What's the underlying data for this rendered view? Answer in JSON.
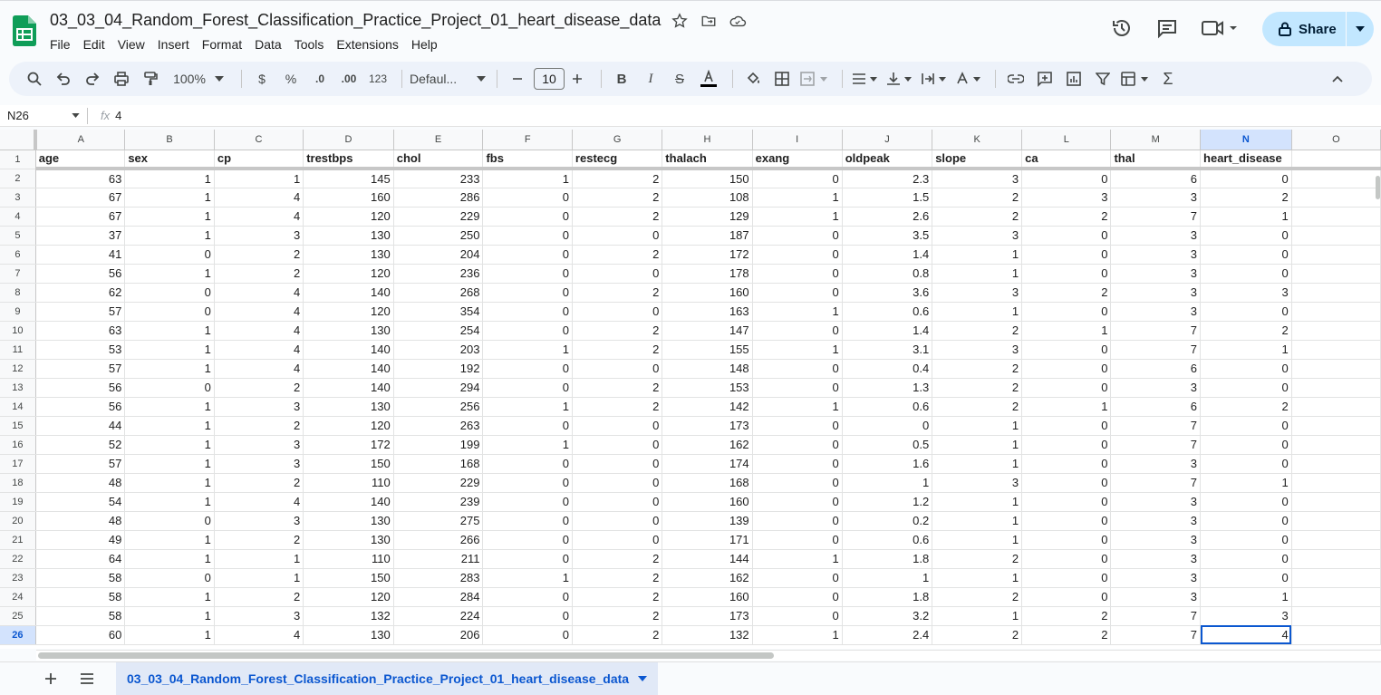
{
  "app": {
    "doc_title": "03_03_04_Random_Forest_Classification_Practice_Project_01_heart_disease_data",
    "share_label": "Share"
  },
  "menu": [
    "File",
    "Edit",
    "View",
    "Insert",
    "Format",
    "Data",
    "Tools",
    "Extensions",
    "Help"
  ],
  "toolbar": {
    "zoom": "100%",
    "currency": "$",
    "percent": "%",
    "dec_decrease": ".0",
    "dec_increase": ".00",
    "more_formats": "123",
    "font": "Defaul...",
    "font_size": "10"
  },
  "formula_bar": {
    "cell_ref": "N26",
    "fx": "fx",
    "value": "4"
  },
  "columns": [
    "A",
    "B",
    "C",
    "D",
    "E",
    "F",
    "G",
    "H",
    "I",
    "J",
    "K",
    "L",
    "M",
    "N",
    "O"
  ],
  "selected_column": "N",
  "selected_row": "26",
  "headers": [
    "age",
    "sex",
    "cp",
    "trestbps",
    "chol",
    "fbs",
    "restecg",
    "thalach",
    "exang",
    "oldpeak",
    "slope",
    "ca",
    "thal",
    "heart_disease"
  ],
  "rows": [
    [
      "63",
      "1",
      "1",
      "145",
      "233",
      "1",
      "2",
      "150",
      "0",
      "2.3",
      "3",
      "0",
      "6",
      "0"
    ],
    [
      "67",
      "1",
      "4",
      "160",
      "286",
      "0",
      "2",
      "108",
      "1",
      "1.5",
      "2",
      "3",
      "3",
      "2"
    ],
    [
      "67",
      "1",
      "4",
      "120",
      "229",
      "0",
      "2",
      "129",
      "1",
      "2.6",
      "2",
      "2",
      "7",
      "1"
    ],
    [
      "37",
      "1",
      "3",
      "130",
      "250",
      "0",
      "0",
      "187",
      "0",
      "3.5",
      "3",
      "0",
      "3",
      "0"
    ],
    [
      "41",
      "0",
      "2",
      "130",
      "204",
      "0",
      "2",
      "172",
      "0",
      "1.4",
      "1",
      "0",
      "3",
      "0"
    ],
    [
      "56",
      "1",
      "2",
      "120",
      "236",
      "0",
      "0",
      "178",
      "0",
      "0.8",
      "1",
      "0",
      "3",
      "0"
    ],
    [
      "62",
      "0",
      "4",
      "140",
      "268",
      "0",
      "2",
      "160",
      "0",
      "3.6",
      "3",
      "2",
      "3",
      "3"
    ],
    [
      "57",
      "0",
      "4",
      "120",
      "354",
      "0",
      "0",
      "163",
      "1",
      "0.6",
      "1",
      "0",
      "3",
      "0"
    ],
    [
      "63",
      "1",
      "4",
      "130",
      "254",
      "0",
      "2",
      "147",
      "0",
      "1.4",
      "2",
      "1",
      "7",
      "2"
    ],
    [
      "53",
      "1",
      "4",
      "140",
      "203",
      "1",
      "2",
      "155",
      "1",
      "3.1",
      "3",
      "0",
      "7",
      "1"
    ],
    [
      "57",
      "1",
      "4",
      "140",
      "192",
      "0",
      "0",
      "148",
      "0",
      "0.4",
      "2",
      "0",
      "6",
      "0"
    ],
    [
      "56",
      "0",
      "2",
      "140",
      "294",
      "0",
      "2",
      "153",
      "0",
      "1.3",
      "2",
      "0",
      "3",
      "0"
    ],
    [
      "56",
      "1",
      "3",
      "130",
      "256",
      "1",
      "2",
      "142",
      "1",
      "0.6",
      "2",
      "1",
      "6",
      "2"
    ],
    [
      "44",
      "1",
      "2",
      "120",
      "263",
      "0",
      "0",
      "173",
      "0",
      "0",
      "1",
      "0",
      "7",
      "0"
    ],
    [
      "52",
      "1",
      "3",
      "172",
      "199",
      "1",
      "0",
      "162",
      "0",
      "0.5",
      "1",
      "0",
      "7",
      "0"
    ],
    [
      "57",
      "1",
      "3",
      "150",
      "168",
      "0",
      "0",
      "174",
      "0",
      "1.6",
      "1",
      "0",
      "3",
      "0"
    ],
    [
      "48",
      "1",
      "2",
      "110",
      "229",
      "0",
      "0",
      "168",
      "0",
      "1",
      "3",
      "0",
      "7",
      "1"
    ],
    [
      "54",
      "1",
      "4",
      "140",
      "239",
      "0",
      "0",
      "160",
      "0",
      "1.2",
      "1",
      "0",
      "3",
      "0"
    ],
    [
      "48",
      "0",
      "3",
      "130",
      "275",
      "0",
      "0",
      "139",
      "0",
      "0.2",
      "1",
      "0",
      "3",
      "0"
    ],
    [
      "49",
      "1",
      "2",
      "130",
      "266",
      "0",
      "0",
      "171",
      "0",
      "0.6",
      "1",
      "0",
      "3",
      "0"
    ],
    [
      "64",
      "1",
      "1",
      "110",
      "211",
      "0",
      "2",
      "144",
      "1",
      "1.8",
      "2",
      "0",
      "3",
      "0"
    ],
    [
      "58",
      "0",
      "1",
      "150",
      "283",
      "1",
      "2",
      "162",
      "0",
      "1",
      "1",
      "0",
      "3",
      "0"
    ],
    [
      "58",
      "1",
      "2",
      "120",
      "284",
      "0",
      "2",
      "160",
      "0",
      "1.8",
      "2",
      "0",
      "3",
      "1"
    ],
    [
      "58",
      "1",
      "3",
      "132",
      "224",
      "0",
      "2",
      "173",
      "0",
      "3.2",
      "1",
      "2",
      "7",
      "3"
    ],
    [
      "60",
      "1",
      "4",
      "130",
      "206",
      "0",
      "2",
      "132",
      "1",
      "2.4",
      "2",
      "2",
      "7",
      "4"
    ]
  ],
  "sheet_tab": {
    "name": "03_03_04_Random_Forest_Classification_Practice_Project_01_heart_disease_data"
  },
  "colors": {
    "accent": "#0b57d0",
    "share_bg": "#c2e7ff",
    "sheets_green": "#0f9d58"
  }
}
